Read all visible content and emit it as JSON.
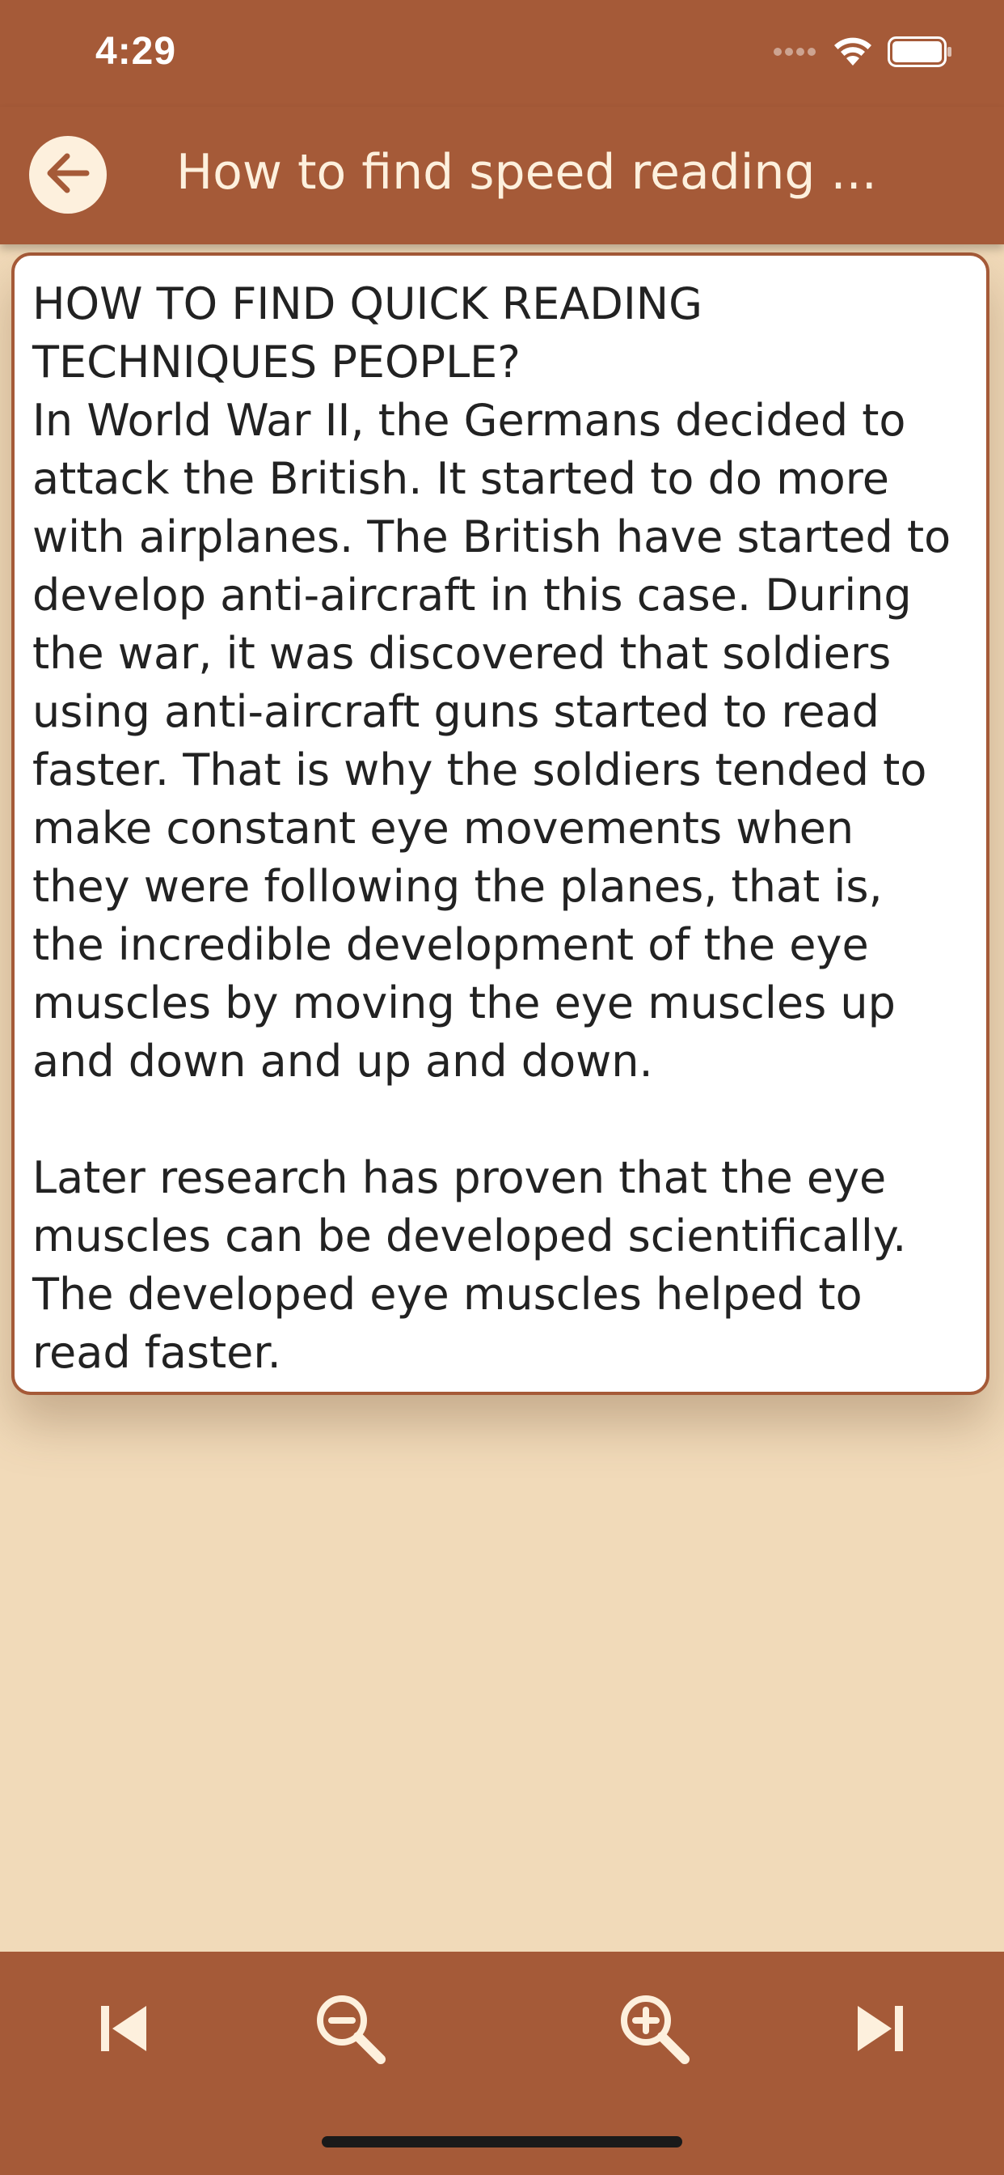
{
  "status_bar": {
    "time": "4:29",
    "icons": [
      "signal-icon",
      "wifi-icon",
      "battery-icon"
    ]
  },
  "app_bar": {
    "back_icon": "arrow-left-icon",
    "title": "How to find speed reading ..."
  },
  "content": {
    "text": "HOW TO FIND QUICK READING\nTECHNIQUES PEOPLE?\nIn World War II, the Germans decided to\nattack the British. It started to do more\nwith airplanes. The British have started to\ndevelop anti-aircraft in this case. During\nthe war, it was discovered that soldiers\nusing anti-aircraft guns started to read\nfaster. That is why the soldiers tended to\nmake constant eye movements when\nthey were following the planes, that is,\nthe incredible development of the eye\nmuscles by moving the eye muscles up\nand down and up and down.\n\nLater research has proven that the eye\nmuscles can be developed scientifically.\nThe developed eye muscles helped to\nread faster."
  },
  "bottom_bar": {
    "buttons": [
      "skip-previous-icon",
      "zoom-out-icon",
      "zoom-in-icon",
      "skip-next-icon"
    ]
  },
  "colors": {
    "primary": "#a55a38",
    "background": "#f1dab9",
    "on_primary": "#fdf0dd",
    "card": "#ffffff",
    "text": "#222222"
  }
}
